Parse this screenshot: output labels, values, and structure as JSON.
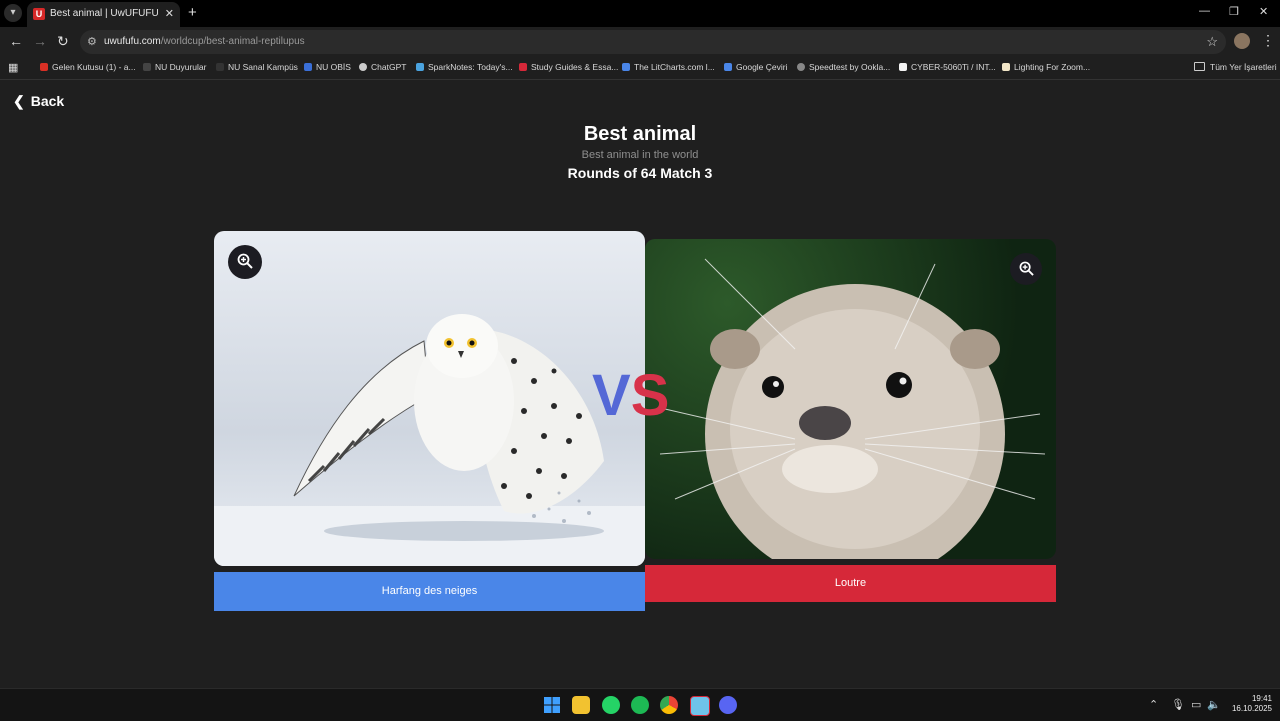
{
  "browser": {
    "tab_title": "Best animal | UwUFUFU",
    "tab_favicon": "U",
    "url_host": "uwufufu.com",
    "url_path": "/worldcup/best-animal-reptilupus",
    "bookmarks": [
      {
        "label": "Gelen Kutusu (1) - a...",
        "color": "#d93025"
      },
      {
        "label": "NU Duyurular",
        "color": "#444444"
      },
      {
        "label": "NU Sanal Kampüs",
        "color": "#333333"
      },
      {
        "label": "NU OBİS",
        "color": "#3a6fd8"
      },
      {
        "label": "ChatGPT",
        "color": "#cccccc"
      },
      {
        "label": "SparkNotes: Today's...",
        "color": "#4aa3df"
      },
      {
        "label": "Study Guides & Essa...",
        "color": "#d62839"
      },
      {
        "label": "The LitCharts.com l...",
        "color": "#4a86e8"
      },
      {
        "label": "Google Çeviri",
        "color": "#4a86e8"
      },
      {
        "label": "Speedtest by Ookla...",
        "color": "#888888"
      },
      {
        "label": "CYBER-5060Ti / INT...",
        "color": "#f2f2f2"
      },
      {
        "label": "Lighting For Zoom...",
        "color": "#f2e6c8"
      }
    ],
    "all_bookmarks_label": "Tüm Yer İşaretleri"
  },
  "page": {
    "back_label": "Back",
    "title": "Best animal",
    "subtitle": "Best animal in the world",
    "round": "Rounds of 64 Match 3",
    "vs_v": "V",
    "vs_s": "S",
    "left_choice": "Harfang des neiges",
    "right_choice": "Loutre"
  },
  "taskbar": {
    "time": "19:41",
    "date": "16.10.2025",
    "apps": [
      "windows-start",
      "file-explorer",
      "whatsapp",
      "spotify",
      "chrome",
      "app-f",
      "discord"
    ]
  }
}
